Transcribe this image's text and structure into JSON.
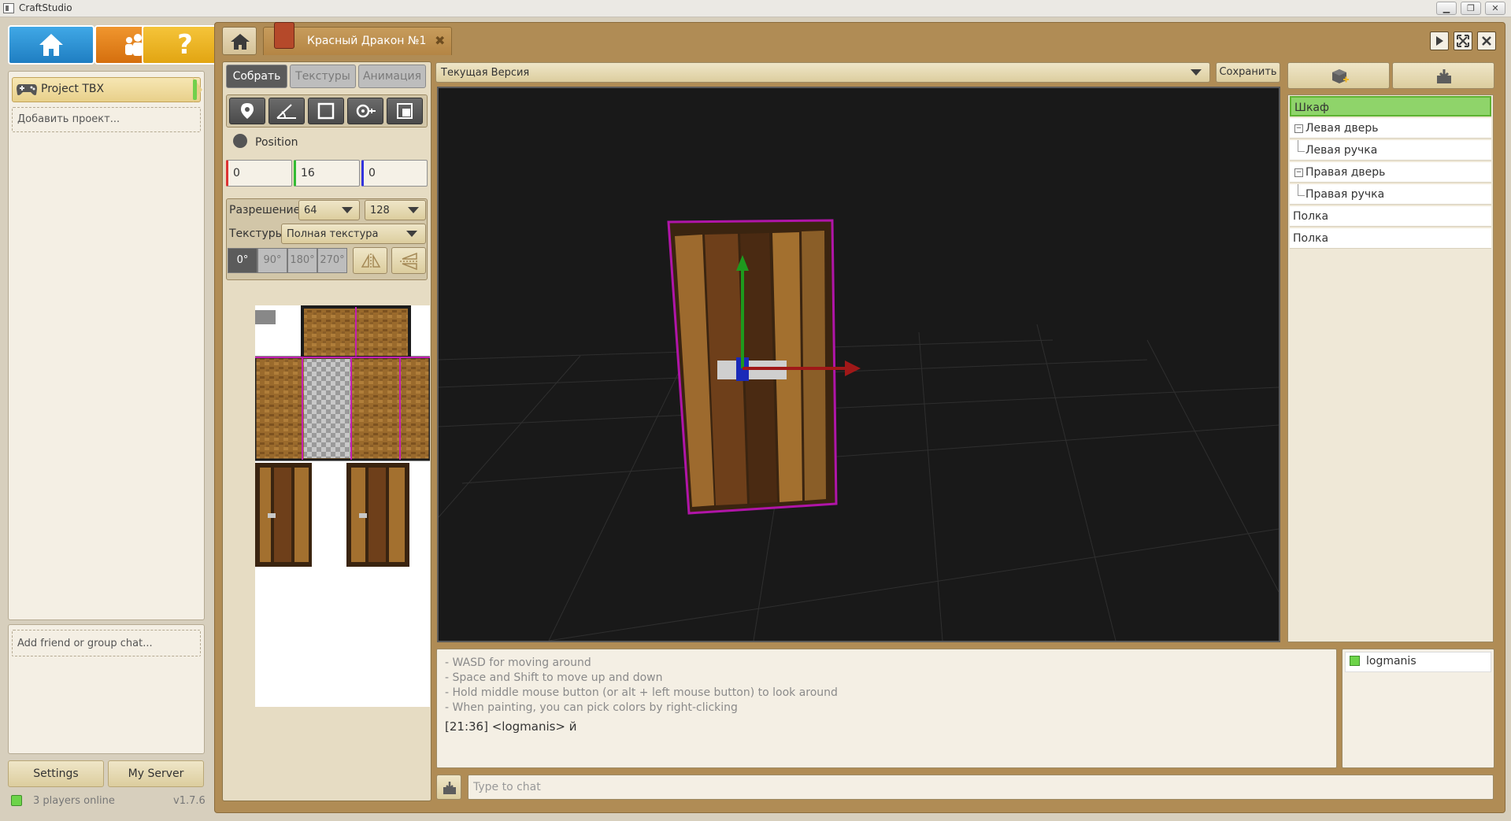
{
  "window": {
    "title": "CraftStudio",
    "controls": [
      "▁",
      "❐",
      "✕"
    ]
  },
  "sidebar": {
    "nav_buttons": [
      {
        "name": "home-icon"
      },
      {
        "name": "community-icon"
      },
      {
        "name": "help-icon",
        "glyph": "?"
      }
    ],
    "projects": [
      {
        "label": "Project TBX",
        "icon": "gamepad-icon",
        "selected": true
      }
    ],
    "add_project_label": "Добавить проект...",
    "add_friend_label": "Add friend or group chat...",
    "settings_label": "Settings",
    "my_server_label": "My Server",
    "online_label": "3 players online",
    "version": "v1.7.6"
  },
  "document_tab": {
    "label": "Красный Дракон №1",
    "close_glyph": "✖"
  },
  "window_controls": [
    "play-icon",
    "fullscreen-icon",
    "close-icon"
  ],
  "modes": {
    "assemble": "Собрать",
    "textures": "Текстуры",
    "animation": "Анимация",
    "active": "assemble"
  },
  "tools": [
    "position-tool-icon",
    "angle-tool-icon",
    "box-tool-icon",
    "pivot-tool-icon",
    "scale-tool-icon"
  ],
  "position": {
    "label": "Position",
    "x": "0",
    "y": "16",
    "z": "0"
  },
  "texture_settings": {
    "resolution_label": "Разрешение",
    "res_w": "64",
    "res_h": "128",
    "textures_label": "Текстуры",
    "texture_mode": "Полная текстура",
    "rotations": [
      "0°",
      "90°",
      "180°",
      "270°"
    ],
    "active_rotation": "0°"
  },
  "version_bar": {
    "selected": "Текущая Версия",
    "save_label": "Сохранить"
  },
  "hierarchy": [
    {
      "label": "Шкаф",
      "depth": 0,
      "selected": true
    },
    {
      "label": "Левая дверь",
      "depth": 1,
      "collapsible": true
    },
    {
      "label": "Левая ручка",
      "depth": 2
    },
    {
      "label": "Правая дверь",
      "depth": 1,
      "collapsible": true
    },
    {
      "label": "Правая ручка",
      "depth": 2
    },
    {
      "label": "Полка",
      "depth": 0
    },
    {
      "label": "Полка",
      "depth": 0
    }
  ],
  "console": {
    "tips": [
      "- WASD for moving around",
      "- Space and Shift to move up and down",
      "- Hold middle mouse button (or alt + left mouse button) to look around",
      "- When painting, you can pick colors by right-clicking"
    ],
    "message": "[21:36] <logmanis> й"
  },
  "players": [
    {
      "name": "logmanis",
      "status_color": "#6dd449"
    }
  ],
  "chat": {
    "placeholder": "Type to chat"
  },
  "colors": {
    "accent_gold": "#b08c55",
    "selection_green": "#8fd46a",
    "home_blue": "#2f93d6",
    "social_orange": "#e3821c",
    "help_yellow": "#f0b726"
  }
}
